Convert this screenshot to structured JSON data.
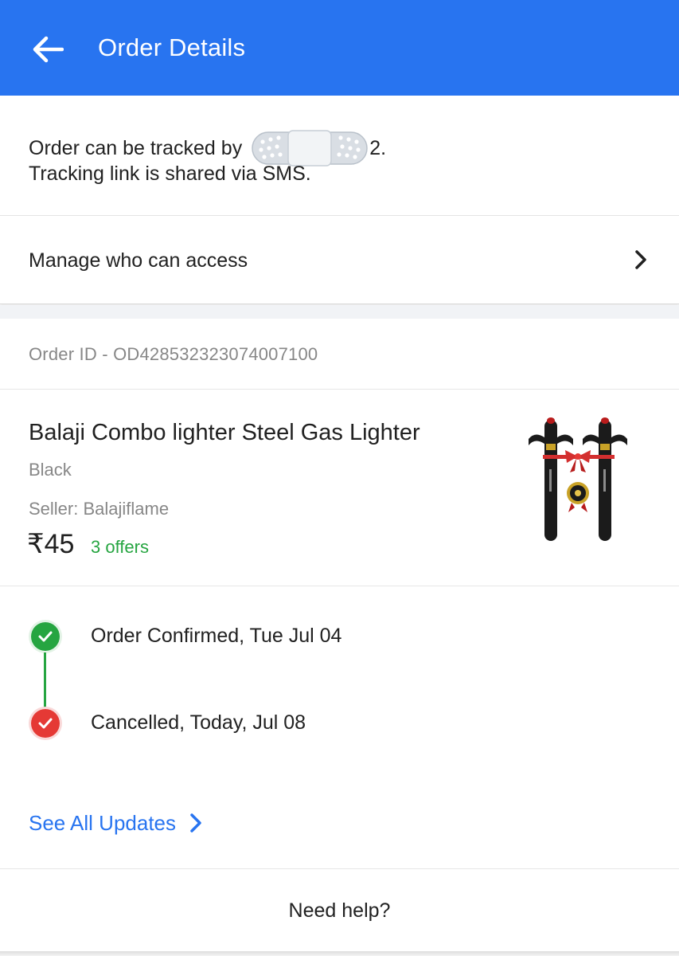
{
  "appbar": {
    "title": "Order Details",
    "background": "#2874f0"
  },
  "tracking": {
    "line1_prefix": "Order can be tracked by",
    "phone_suffix": "2.",
    "line2": "Tracking link is shared via SMS."
  },
  "manage_access": {
    "label": "Manage who can access"
  },
  "order": {
    "id_text": "Order ID - OD428532323074007100"
  },
  "product": {
    "name": "Balaji Combo lighter Steel Gas Lighter",
    "variant": "Black",
    "seller": "Seller: Balajiflame",
    "price": "₹45",
    "offers": "3 offers"
  },
  "timeline": {
    "steps": [
      {
        "label": "Order Confirmed, Tue Jul 04",
        "status": "confirmed",
        "color": "#26a541"
      },
      {
        "label": "Cancelled, Today, Jul 08",
        "status": "cancelled",
        "color": "#e53935"
      }
    ]
  },
  "updates": {
    "see_all_label": "See All Updates"
  },
  "help": {
    "label": "Need help?"
  },
  "colors": {
    "accent": "#2874f0",
    "success": "#26a541",
    "danger": "#e53935",
    "muted_text": "#878787"
  }
}
